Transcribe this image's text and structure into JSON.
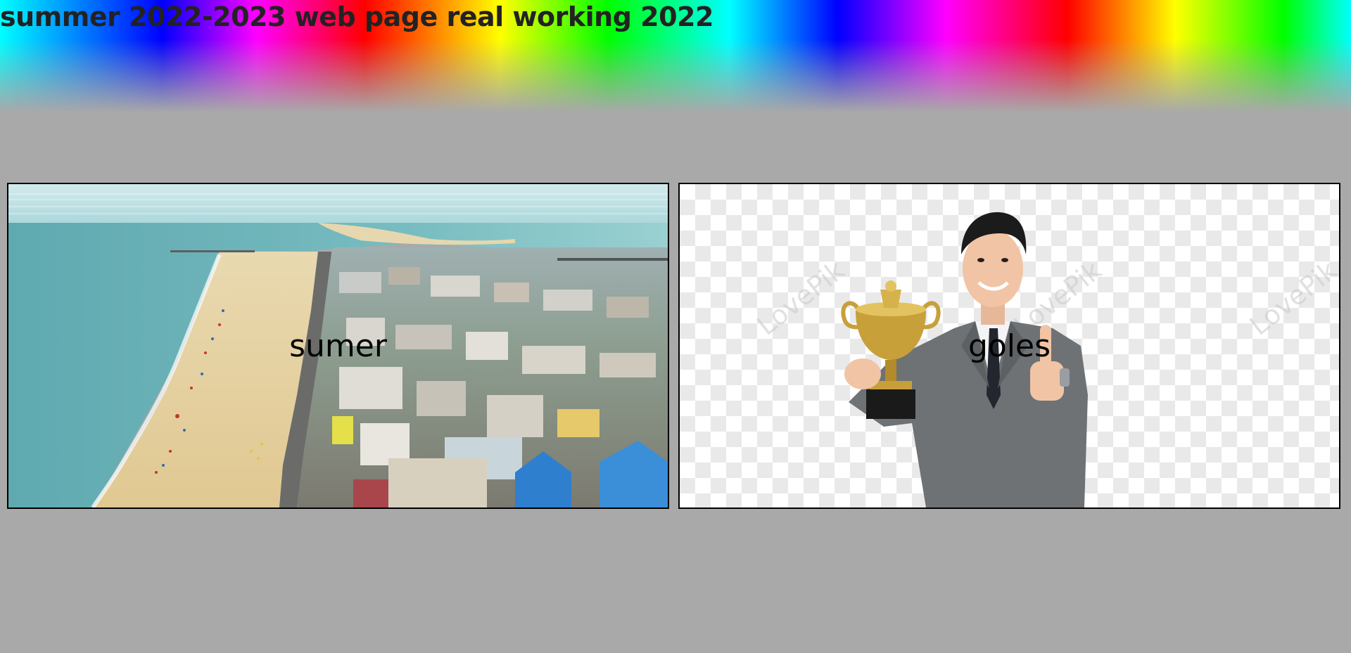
{
  "page": {
    "title": "summer 2022-2023 web page real working 2022"
  },
  "cards": [
    {
      "caption": "sumer",
      "image": "aerial beach and town photo"
    },
    {
      "caption": "goles",
      "image": "businessman holding trophy photo",
      "watermark": "LovePik"
    }
  ],
  "colors": {
    "background": "#a9a9a9",
    "card_border": "#000000"
  }
}
